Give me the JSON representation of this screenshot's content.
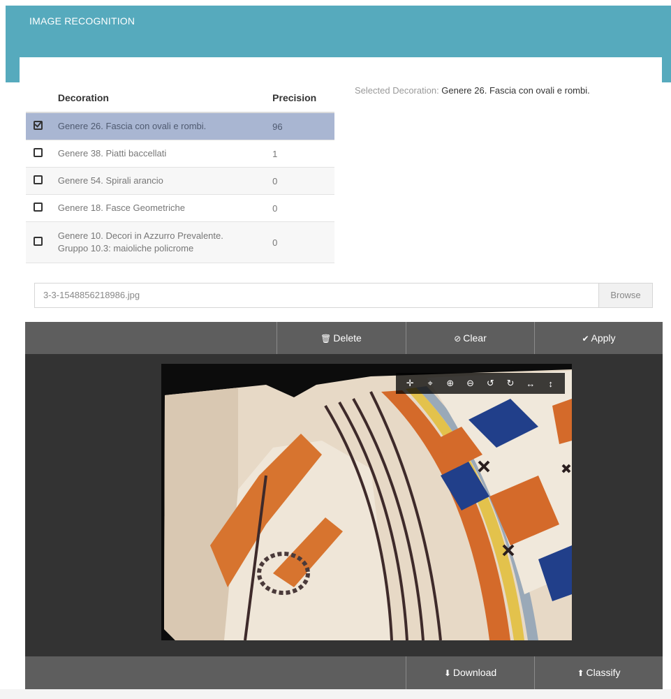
{
  "header": {
    "title": "IMAGE RECOGNITION"
  },
  "table": {
    "col_decoration": "Decoration",
    "col_precision": "Precision",
    "rows": [
      {
        "name": "Genere 26. Fascia con ovali e rombi.",
        "precision": "96",
        "selected": true
      },
      {
        "name": "Genere 38. Piatti baccellati",
        "precision": "1",
        "selected": false
      },
      {
        "name": "Genere 54. Spirali arancio",
        "precision": "0",
        "selected": false
      },
      {
        "name": "Genere 18. Fasce Geometriche",
        "precision": "0",
        "selected": false
      },
      {
        "name_line1": "Genere 10. Decori in Azzurro Prevalente.",
        "name_line2": "Gruppo 10.3: maioliche policrome",
        "precision": "0",
        "selected": false
      }
    ]
  },
  "selected": {
    "label": "Selected Decoration: ",
    "value": "Genere 26. Fascia con ovali e rombi."
  },
  "file": {
    "name": "3-3-1548856218986.jpg",
    "browse_label": "Browse"
  },
  "toolbar": {
    "delete_label": "Delete",
    "clear_label": "Clear",
    "apply_label": "Apply"
  },
  "bottom": {
    "download_label": "Download",
    "classify_label": "Classify"
  },
  "icons": {
    "delete": "trash-icon",
    "clear": "ban-icon",
    "apply": "check-icon",
    "download": "download-icon",
    "classify": "upload-icon",
    "crop_tools": [
      "move-icon",
      "crop-icon",
      "zoom-in-icon",
      "zoom-out-icon",
      "rotate-left-icon",
      "rotate-right-icon",
      "flip-horizontal-icon",
      "flip-vertical-icon"
    ]
  },
  "colors": {
    "header": "#56aabd",
    "selected_row": "#a9b6d2",
    "toolbar": "#5e5e5e",
    "canvas": "#333333"
  }
}
